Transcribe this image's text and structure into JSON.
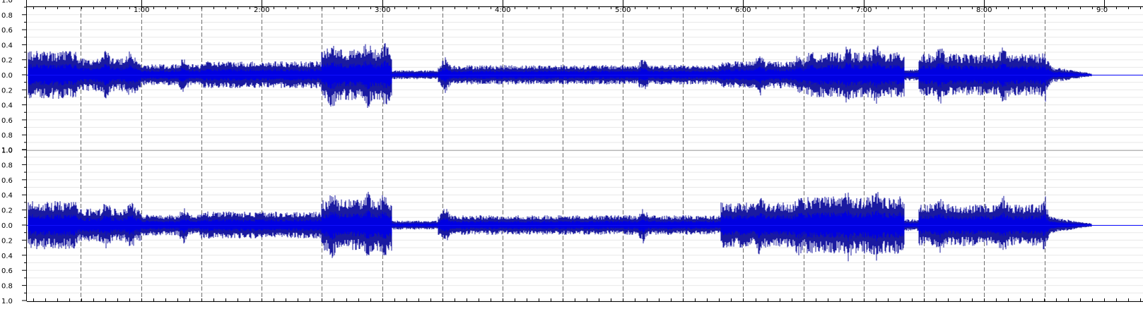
{
  "time_ruler": {
    "labels": [
      "1:00",
      "2:00",
      "3:00",
      "4:00",
      "5:00",
      "6:00",
      "7:00",
      "8:00",
      "9:0"
    ]
  },
  "amplitude_scale": {
    "labels": [
      "1.0",
      "0.8",
      "0.6",
      "0.4",
      "0.2",
      "0.0",
      "0.2",
      "0.4",
      "0.6",
      "0.8"
    ]
  },
  "tracks": [
    {
      "id": "channel-left"
    },
    {
      "id": "channel-right"
    }
  ],
  "colors": {
    "background": "#ffffff",
    "gridline": "#e8e8e8",
    "time_divider": "#707070",
    "centerline": "#1010ff",
    "waveform_fill": "#1a1aa0",
    "waveform_core": "#0000e0",
    "channel_separator": "#b0b0b0"
  }
}
